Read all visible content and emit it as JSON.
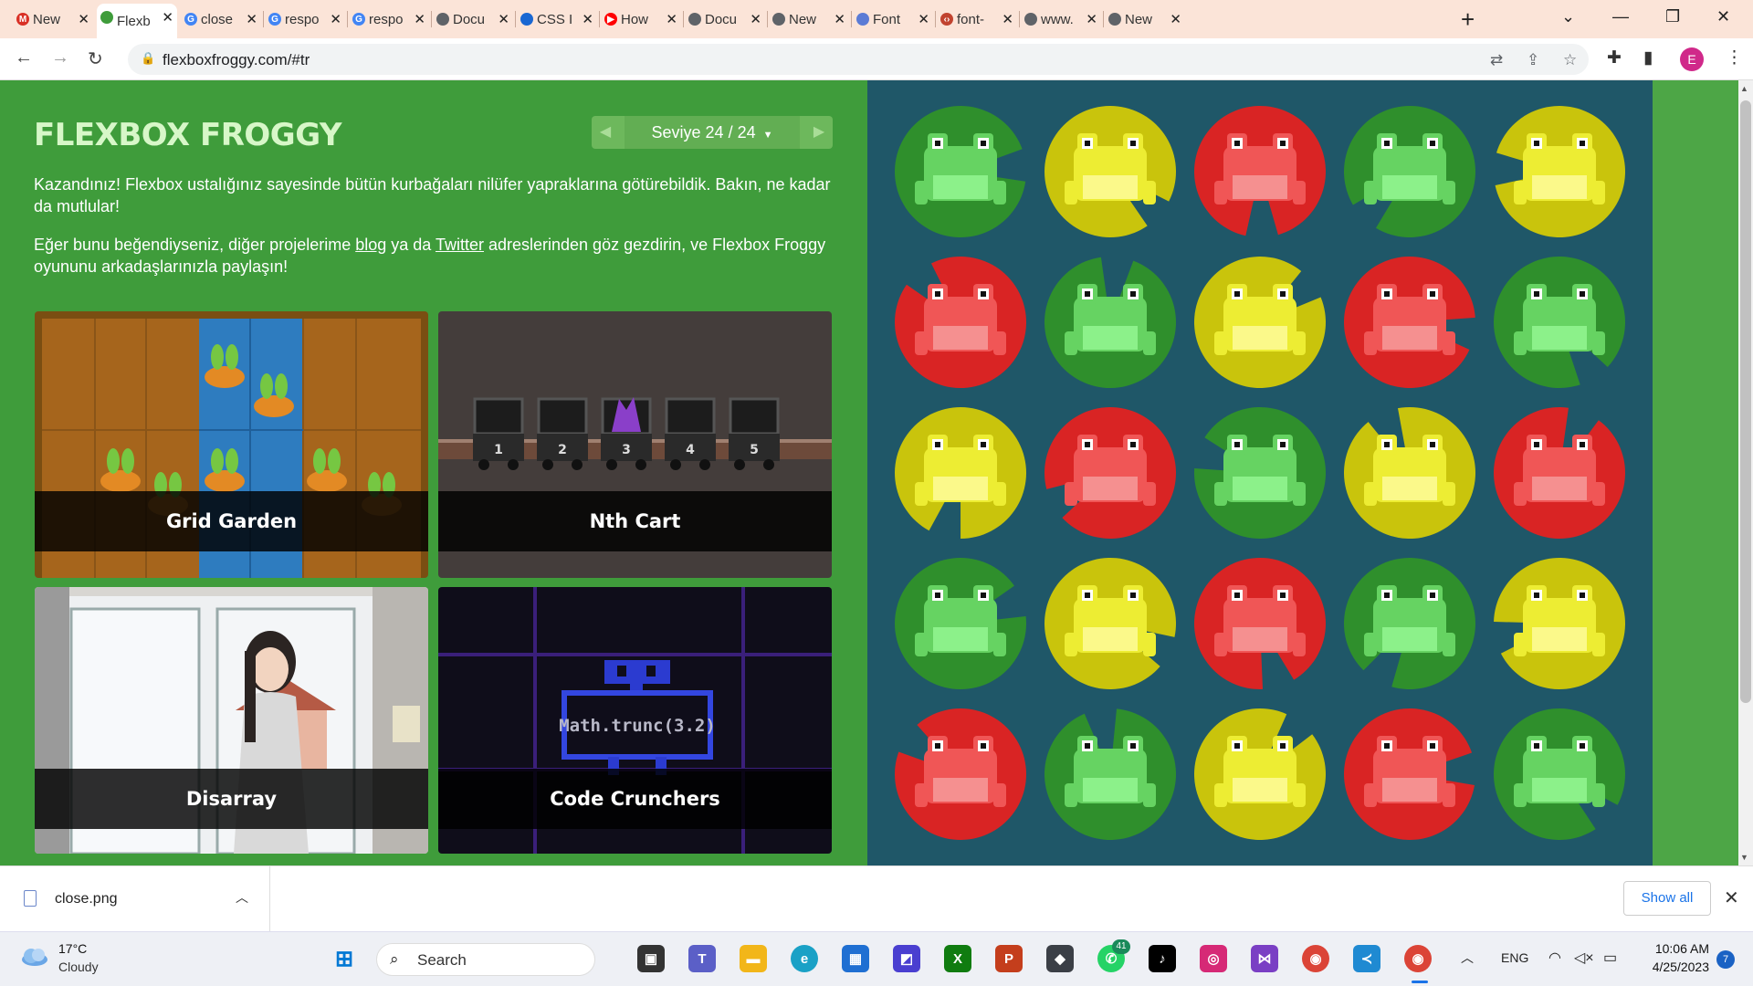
{
  "browser": {
    "tabs": [
      {
        "title": "New",
        "favicon": "gmail-icon",
        "color": "#d93025",
        "glyph": "M"
      },
      {
        "title": "Flexb",
        "favicon": "frog-icon",
        "color": "#3f9c3b",
        "glyph": "",
        "active": true
      },
      {
        "title": "close",
        "favicon": "google-icon",
        "color": "#4285f4",
        "glyph": "G"
      },
      {
        "title": "respo",
        "favicon": "google-icon",
        "color": "#4285f4",
        "glyph": "G"
      },
      {
        "title": "respo",
        "favicon": "google-icon",
        "color": "#4285f4",
        "glyph": "G"
      },
      {
        "title": "Docu",
        "favicon": "globe-icon",
        "color": "#5f6368",
        "glyph": ""
      },
      {
        "title": "CSS I",
        "favicon": "classroom-icon",
        "color": "#1967d2",
        "glyph": ""
      },
      {
        "title": "How",
        "favicon": "youtube-icon",
        "color": "#ff0000",
        "glyph": "▶"
      },
      {
        "title": "Docu",
        "favicon": "globe-icon",
        "color": "#5f6368",
        "glyph": ""
      },
      {
        "title": "New",
        "favicon": "chrome-icon",
        "color": "#5f6368",
        "glyph": ""
      },
      {
        "title": "Font",
        "favicon": "flag-icon",
        "color": "#5b7bd5",
        "glyph": ""
      },
      {
        "title": "font-",
        "favicon": "code-icon",
        "color": "#c1432f",
        "glyph": "‹›"
      },
      {
        "title": "www.",
        "favicon": "globe-icon",
        "color": "#5f6368",
        "glyph": ""
      },
      {
        "title": "New",
        "favicon": "chrome-icon",
        "color": "#5f6368",
        "glyph": ""
      }
    ],
    "url": "flexboxfroggy.com/#tr",
    "profile_initial": "E"
  },
  "game": {
    "title": "FLEXBOX FROGGY",
    "level_label": "Seviye 24 / 24",
    "win_text": "Kazandınız! Flexbox ustalığınız sayesinde bütün kurbağaları nilüfer yapraklarına götürebildik. Bakın, ne kadar da mutlular!",
    "share_text_1": "Eğer bunu beğendiyseniz, diğer projelerime ",
    "blog_link": "blog",
    "share_text_2": " ya da ",
    "twitter_link": "Twitter",
    "share_text_3": " adreslerinden göz gezdirin, ve Flexbox Froggy oyununu arkadaşlarınızla paylaşın!",
    "cards": [
      {
        "title": "Grid Garden"
      },
      {
        "title": "Nth Cart"
      },
      {
        "title": "Disarray"
      },
      {
        "title": "Code Crunchers"
      }
    ],
    "cart_numbers": [
      "1",
      "2",
      "3",
      "4",
      "5"
    ],
    "code_text": "Math.trunc(3.2)",
    "frog_grid": [
      [
        "green",
        "yellow",
        "red",
        "green",
        "yellow"
      ],
      [
        "red",
        "green",
        "yellow",
        "red",
        "green"
      ],
      [
        "yellow",
        "red",
        "green",
        "yellow",
        "red"
      ],
      [
        "green",
        "yellow",
        "red",
        "green",
        "yellow"
      ],
      [
        "red",
        "green",
        "yellow",
        "red",
        "green"
      ]
    ],
    "colors": {
      "green": {
        "pad": "#2f8f2c",
        "frog": "#66d362",
        "belly": "#8cf18a"
      },
      "yellow": {
        "pad": "#c9c40c",
        "frog": "#eded33",
        "belly": "#fbf98a"
      },
      "red": {
        "pad": "#d92424",
        "frog": "#f05656",
        "belly": "#f59090"
      }
    }
  },
  "downloads": {
    "file": "close.png",
    "show_all": "Show all"
  },
  "taskbar": {
    "temp": "17°C",
    "condition": "Cloudy",
    "search_label": "Search",
    "whatsapp_badge": "41",
    "lang": "ENG",
    "time": "10:06 AM",
    "date": "4/25/2023",
    "notifications": "7"
  }
}
